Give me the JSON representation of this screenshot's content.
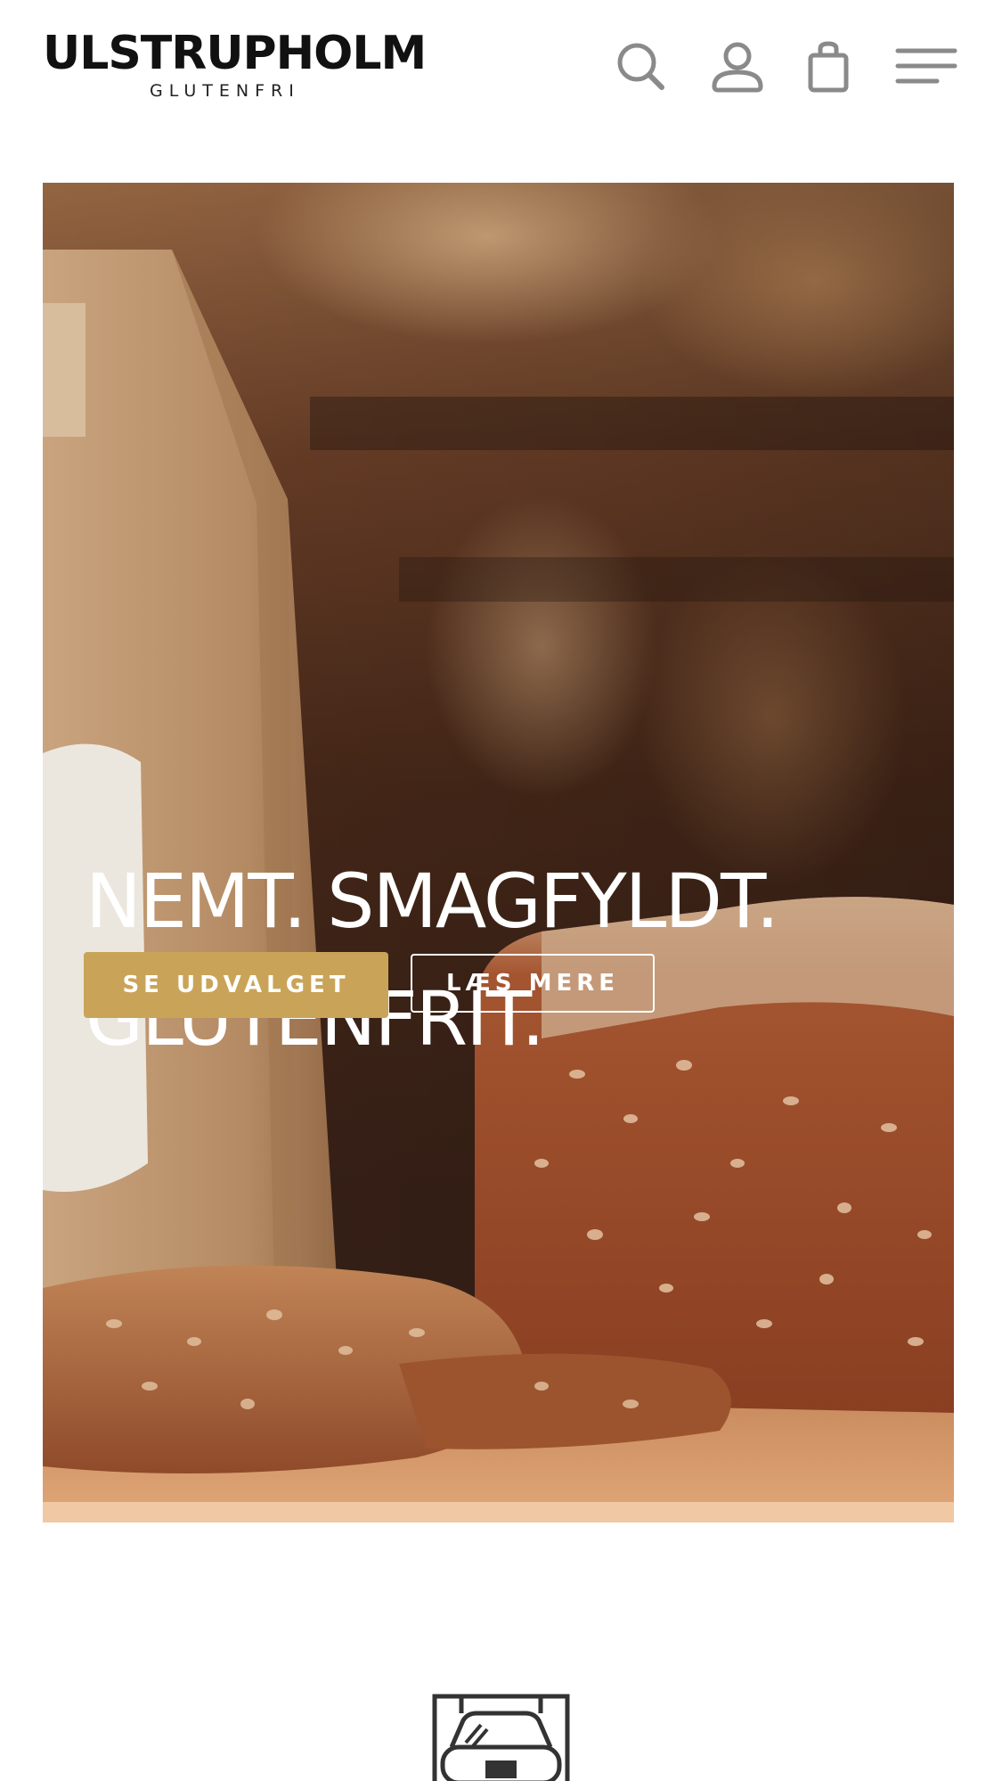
{
  "header": {
    "logo": {
      "name": "ULSTRUPHOLM",
      "tagline": "GLUTENFRI"
    },
    "icons": {
      "search": "search-icon",
      "account": "user-icon",
      "cart": "shopping-bag-icon",
      "menu": "hamburger-menu-icon"
    }
  },
  "hero": {
    "title_line1": "NEMT. SMAGFYLDT.",
    "title_line2": "GLUTENFRIT.",
    "primary_button": "SE UDVALGET",
    "secondary_button": "LÆS MERE"
  },
  "feature": {
    "icon": "oven-icon"
  },
  "colors": {
    "accent": "#c9a458",
    "text_dark": "#111111",
    "icon_gray": "#8a8a8a",
    "background": "#ffffff"
  }
}
